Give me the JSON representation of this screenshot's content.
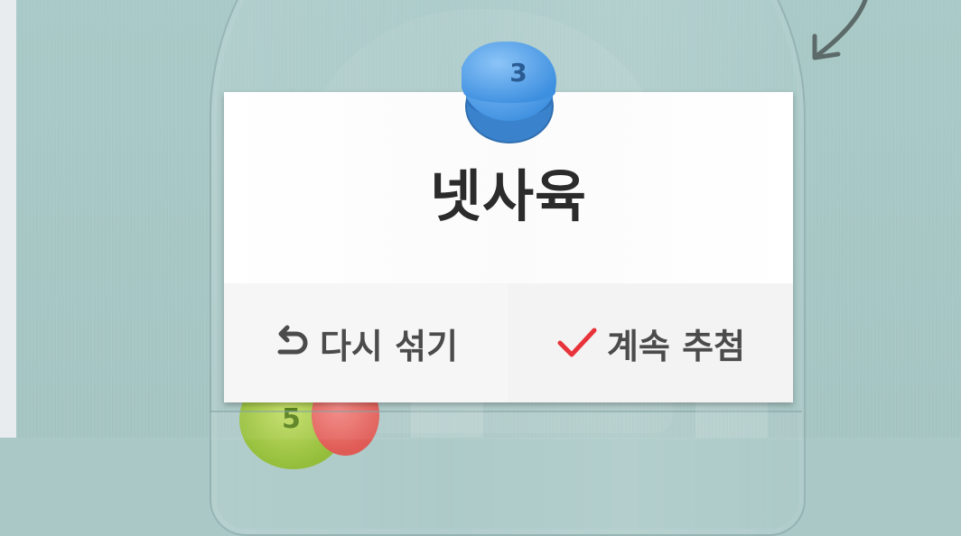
{
  "dialog": {
    "result_text": "넷사육",
    "ball_number": "3",
    "reshuffle_label": "다시 섞기",
    "continue_label": "계속 추첨"
  },
  "decor": {
    "bottom_ball_number": "5"
  },
  "colors": {
    "background": "#a9c8c6",
    "ball_blue": "#4b9be6",
    "check_red": "#e8333a",
    "text_dark": "#2b2b2b"
  },
  "icons": {
    "reshuffle": "undo-icon",
    "continue": "checkmark-icon"
  }
}
